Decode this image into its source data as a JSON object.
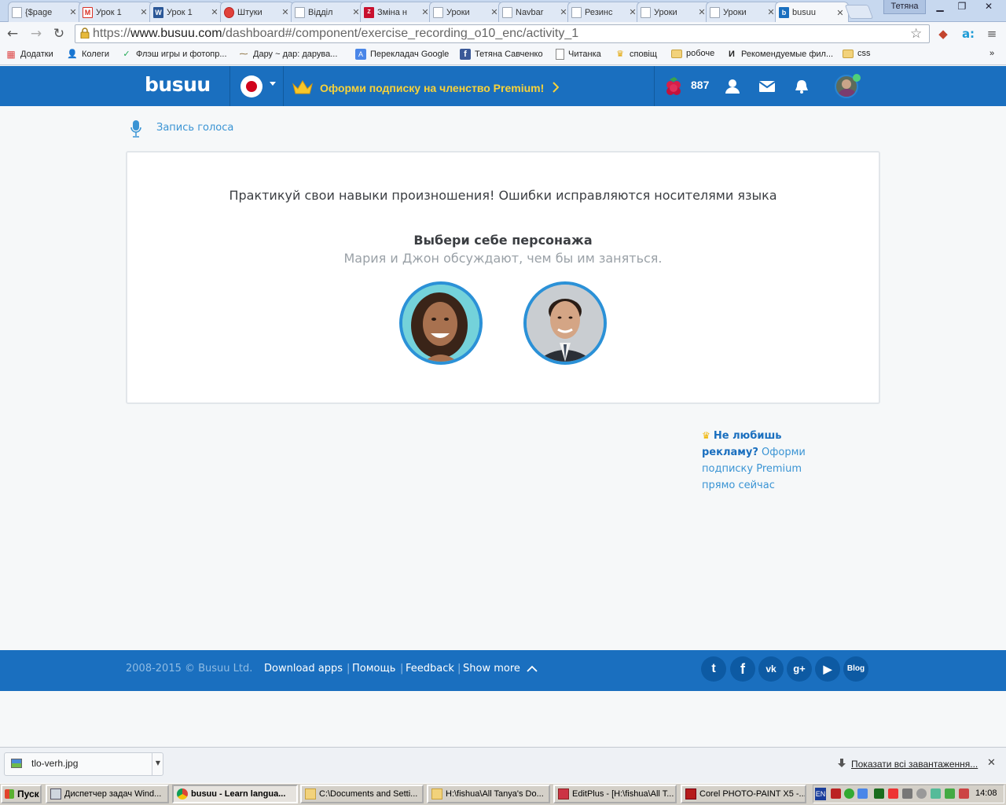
{
  "browser": {
    "tabs": [
      {
        "label": "{$page",
        "icon": "doc-icon"
      },
      {
        "label": "Урок 1",
        "icon": "gmail-icon"
      },
      {
        "label": "Урок 1",
        "icon": "word-icon"
      },
      {
        "label": "Штуки",
        "icon": "red-circle-icon"
      },
      {
        "label": "Відділ",
        "icon": "doc-icon"
      },
      {
        "label": "Зміна н",
        "icon": "znu-icon"
      },
      {
        "label": "Уроки",
        "icon": "doc-icon"
      },
      {
        "label": "Navbar",
        "icon": "doc-icon"
      },
      {
        "label": "Резинс",
        "icon": "doc-icon"
      },
      {
        "label": "Уроки",
        "icon": "doc-icon"
      },
      {
        "label": "Уроки",
        "icon": "doc-icon"
      },
      {
        "label": "busuu",
        "icon": "busuu-icon"
      }
    ],
    "profile_name": "Тетяна",
    "url_prefix": "https://",
    "url_host": "www.busuu.com",
    "url_path": "/dashboard#/component/exercise_recording_o10_enc/activity_1",
    "bookmarks": [
      {
        "label": "Додатки",
        "icon": "apps-icon"
      },
      {
        "label": "Колеги",
        "icon": "user-icon"
      },
      {
        "label": "Флэш игры и фотопр...",
        "icon": "bookmark-icon"
      },
      {
        "label": "Дару ~ дар: дарува...",
        "icon": "bookmark-icon"
      },
      {
        "label": "Перекладач Google",
        "icon": "translate-icon"
      },
      {
        "label": "Тетяна Савченко",
        "icon": "facebook-icon"
      },
      {
        "label": "Читанка",
        "icon": "page-icon"
      },
      {
        "label": "сповіщ",
        "icon": "crown-icon"
      },
      {
        "label": "робоче",
        "icon": "folder-icon"
      },
      {
        "label": "Рекомендуемые фил...",
        "icon": "ivi-icon"
      },
      {
        "label": "css",
        "icon": "folder-icon"
      }
    ]
  },
  "header": {
    "logo": "busuu",
    "promo": "Оформи подписку на членство Premium!",
    "points": "887"
  },
  "breadcrumb": "Запись голоса",
  "exercise": {
    "intro": "Практикуй свои навыки произношения! Ошибки исправляются носителями языка",
    "choose_title": "Выбери себе персонажа",
    "subtitle": "Мария и Джон обсуждают, чем бы им заняться."
  },
  "ad": {
    "bold": "Не любишь рекламу?",
    "text": "Оформи подписку Premium прямо сейчас"
  },
  "footer": {
    "copyright": "2008-2015 © Busuu Ltd.",
    "links": [
      "Download apps",
      "Помощь",
      "Feedback",
      "Show more"
    ],
    "blog": "Blog"
  },
  "downloads": {
    "file": "tlo-verh.jpg",
    "show_all": "Показати всі завантаження..."
  },
  "taskbar": {
    "start": "Пуск",
    "tasks": [
      "Диспетчер задач Wind...",
      "busuu - Learn langua...",
      "C:\\Documents and Setti...",
      "H:\\fishua\\All Tanya's Do...",
      "EditPlus - [H:\\fishua\\All T...",
      "Corel PHOTO-PAINT X5 -..."
    ],
    "lang": "EN",
    "clock": "14:08"
  },
  "colors": {
    "brand": "#1a6fbf",
    "accent": "#2b91d7",
    "promo": "#f7d23a"
  }
}
